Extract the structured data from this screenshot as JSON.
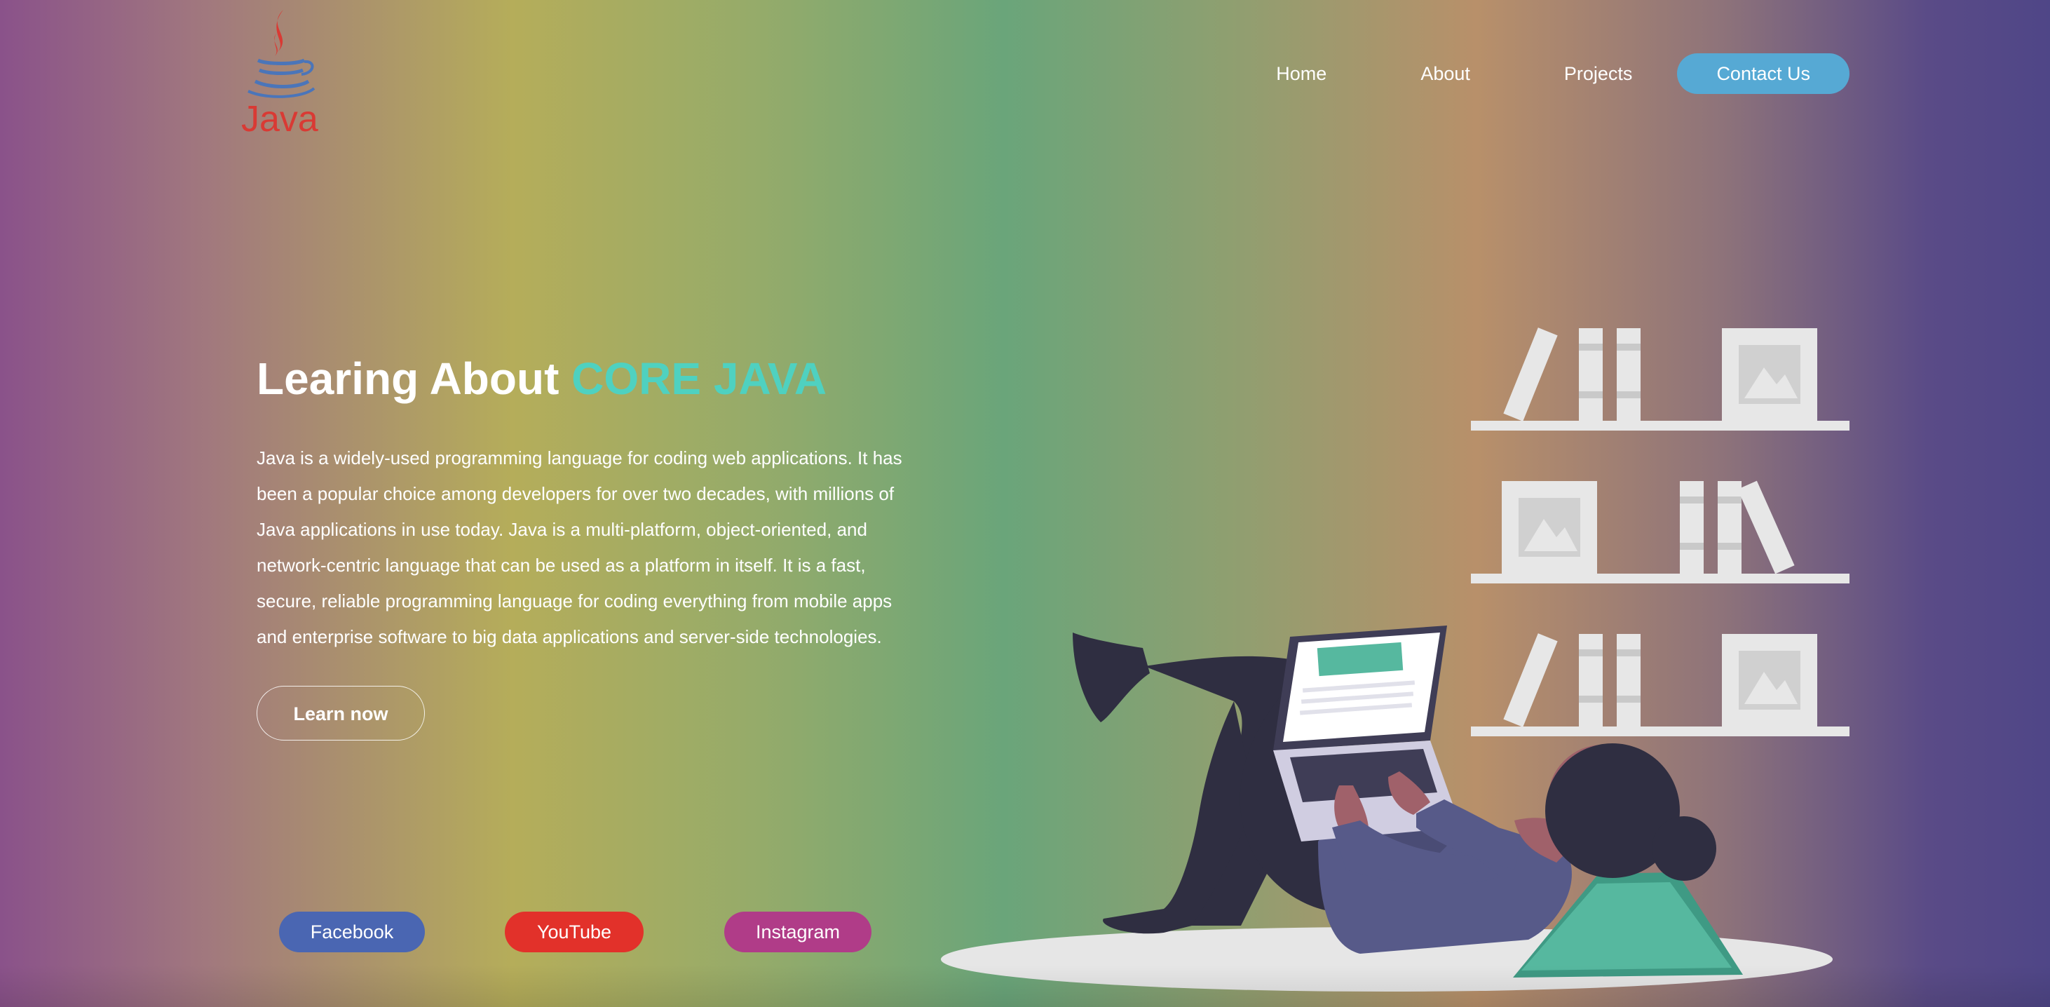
{
  "brand": {
    "logo_text": "Java",
    "colors": {
      "logo_red": "#d93a34",
      "logo_blue": "#4b75b9"
    }
  },
  "nav": {
    "home": "Home",
    "about": "About",
    "projects": "Projects",
    "contact": "Contact Us"
  },
  "hero": {
    "title_lead": "Learing About ",
    "title_accent": "CORE JAVA",
    "body": "Java is a widely-used programming language for coding web applications. It has been a popular choice among developers for over two decades, with millions of Java applications in use today. Java is a multi-platform, object-oriented, and network-centric language that can be used as a platform in itself. It is a fast, secure, reliable programming language for coding everything from mobile apps and enterprise software to big data applications and server-side technologies.",
    "cta_label": "Learn now"
  },
  "social": {
    "facebook": "Facebook",
    "youtube": "YouTube",
    "instagram": "Instagram"
  },
  "colors": {
    "accent_teal": "#4fd1c0",
    "contact_blue": "#56a9d4",
    "facebook_blue": "#4a66b2",
    "youtube_red": "#e2312a",
    "instagram_magenta": "#b03c88"
  },
  "illustration": {
    "icon": "person-reading-laptop-bookshelf-illustration"
  }
}
